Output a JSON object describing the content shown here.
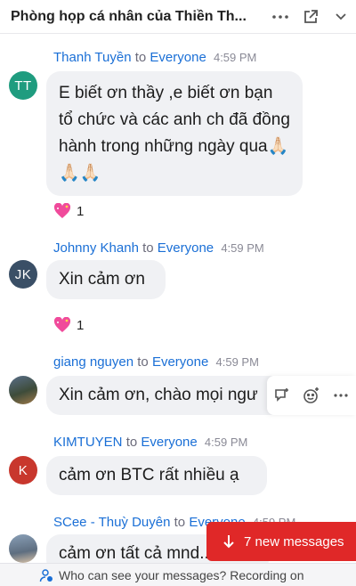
{
  "header": {
    "title": "Phòng họp cá nhân của Thiền Th...",
    "more_icon": "more-horizontal-icon",
    "popout_icon": "popout-window-icon"
  },
  "messages": [
    {
      "sender": "Thanh Tuyền",
      "to": "to",
      "audience": "Everyone",
      "time": "4:59 PM",
      "avatar_initials": "TT",
      "avatar_color": "#1f9c7f",
      "text": "E biết ơn thầy ,e biết ơn bạn tổ chức và các anh ch đã đồng hành trong những ngày qua🙏🏻🙏🏻🙏🏻",
      "reaction_count": "1"
    },
    {
      "sender": "Johnny Khanh",
      "to": "to",
      "audience": "Everyone",
      "time": "4:59 PM",
      "avatar_initials": "JK",
      "avatar_color": "#3a4f66",
      "text": "Xin cảm ơn",
      "reaction_count": "1"
    },
    {
      "sender": "giang nguyen",
      "to": "to",
      "audience": "Everyone",
      "time": "4:59 PM",
      "avatar_initials": "",
      "text": "Xin cảm ơn, chào mọi ngư"
    },
    {
      "sender": "KIMTUYEN",
      "to": "to",
      "audience": "Everyone",
      "time": "4:59 PM",
      "avatar_initials": "K",
      "avatar_color": "#c8372d",
      "text": "cảm ơn BTC rất nhiều ạ"
    },
    {
      "sender": "SCee - Thuỳ Duyên",
      "to": "to",
      "audience": "Everyone",
      "time": "4:59 PM",
      "avatar_initials": "",
      "text": "cảm ơn tất cả mnd...."
    }
  ],
  "new_messages_label": "7 new messages",
  "footer_text": "Who can see your messages? Recording on"
}
